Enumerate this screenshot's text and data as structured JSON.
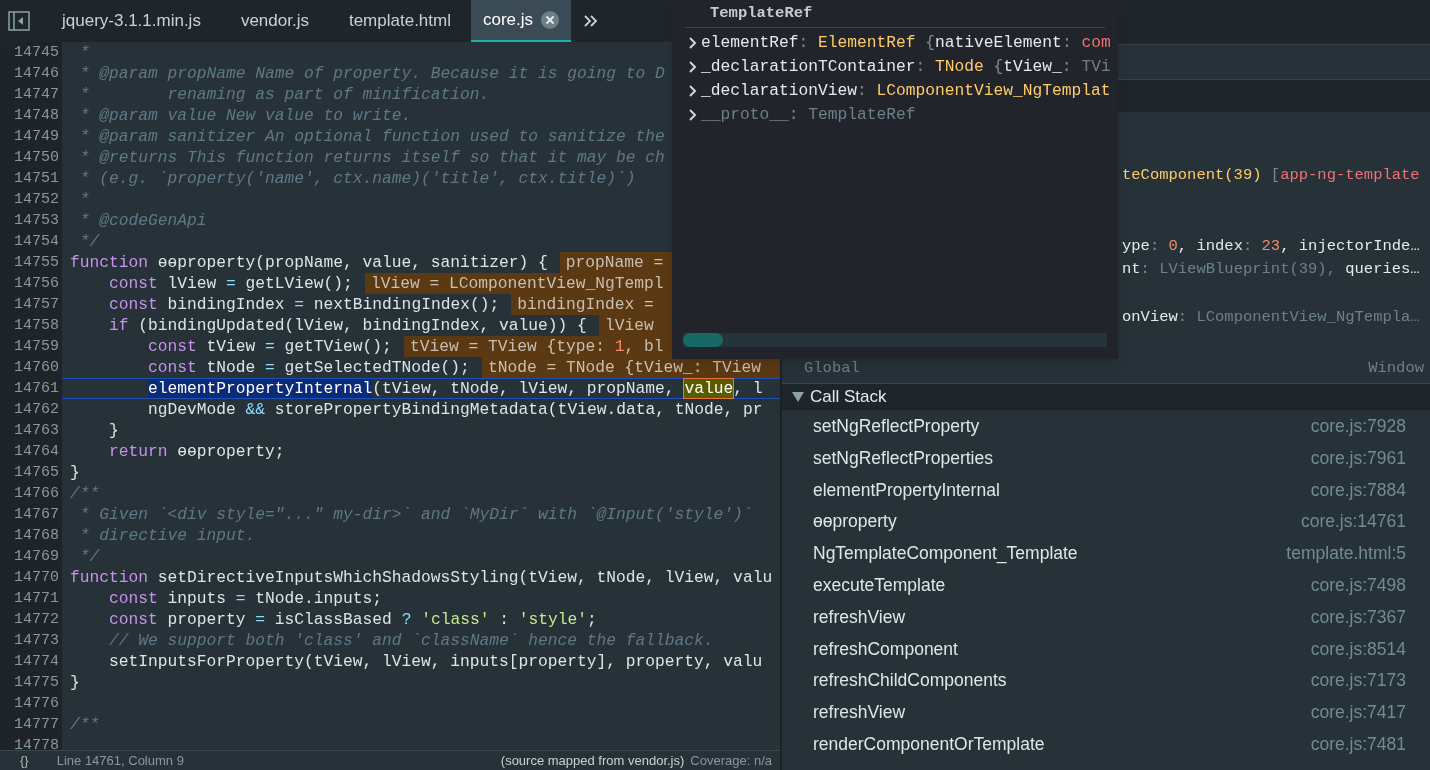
{
  "tabs": [
    {
      "label": "jquery-3.1.1.min.js",
      "selected": false
    },
    {
      "label": "vendor.js",
      "selected": false
    },
    {
      "label": "template.html",
      "selected": false
    },
    {
      "label": "core.js",
      "selected": true
    }
  ],
  "code": {
    "lines": [
      {
        "number": "14745",
        "tokens": [
          {
            "kind": "comment",
            "text": " *"
          }
        ]
      },
      {
        "number": "14746",
        "tokens": [
          {
            "kind": "comment",
            "text": " * @param propName Name of property. Because it is going to D"
          }
        ]
      },
      {
        "number": "14747",
        "tokens": [
          {
            "kind": "comment",
            "text": " *        renaming as part of minification."
          }
        ]
      },
      {
        "number": "14748",
        "tokens": [
          {
            "kind": "comment",
            "text": " * @param value New value to write."
          }
        ]
      },
      {
        "number": "14749",
        "tokens": [
          {
            "kind": "comment",
            "text": " * @param sanitizer An optional function used to sanitize the"
          }
        ]
      },
      {
        "number": "14750",
        "tokens": [
          {
            "kind": "comment",
            "text": " * @returns This function returns itself so that it may be ch"
          }
        ]
      },
      {
        "number": "14751",
        "tokens": [
          {
            "kind": "comment",
            "text": " * (e.g. `property('name', ctx.name)('title', ctx.title)`)"
          }
        ]
      },
      {
        "number": "14752",
        "tokens": [
          {
            "kind": "comment",
            "text": " *"
          }
        ]
      },
      {
        "number": "14753",
        "tokens": [
          {
            "kind": "comment",
            "text": " * @codeGenApi"
          }
        ]
      },
      {
        "number": "14754",
        "tokens": [
          {
            "kind": "comment",
            "text": " */"
          }
        ]
      },
      {
        "number": "14755",
        "tokens": [
          {
            "kind": "keyword",
            "text": "function"
          },
          {
            "kind": "plain",
            "text": " ɵɵproperty(propName, value, sanitizer) {"
          }
        ],
        "inline_value": [
          {
            "kind": "plain",
            "text": "propName ="
          }
        ]
      },
      {
        "number": "14756",
        "tokens": [
          {
            "kind": "keyword",
            "text": "    const"
          },
          {
            "kind": "plain",
            "text": " lView "
          },
          {
            "kind": "operator",
            "text": "="
          },
          {
            "kind": "plain",
            "text": " getLView();"
          }
        ],
        "inline_value": [
          {
            "kind": "plain",
            "text": "lView = LComponentView_NgTempl"
          }
        ]
      },
      {
        "number": "14757",
        "tokens": [
          {
            "kind": "keyword",
            "text": "    const"
          },
          {
            "kind": "plain",
            "text": " bindingIndex "
          },
          {
            "kind": "operator",
            "text": "="
          },
          {
            "kind": "plain",
            "text": " nextBindingIndex();"
          }
        ],
        "inline_value": [
          {
            "kind": "plain",
            "text": "bindingIndex ="
          }
        ]
      },
      {
        "number": "14758",
        "tokens": [
          {
            "kind": "keyword",
            "text": "    if"
          },
          {
            "kind": "plain",
            "text": " (bindingUpdated(lView, bindingIndex, value)) {"
          }
        ],
        "inline_value": [
          {
            "kind": "plain",
            "text": "lView"
          }
        ]
      },
      {
        "number": "14759",
        "tokens": [
          {
            "kind": "keyword",
            "text": "        const"
          },
          {
            "kind": "plain",
            "text": " tView "
          },
          {
            "kind": "operator",
            "text": "="
          },
          {
            "kind": "plain",
            "text": " getTView();"
          }
        ],
        "inline_value": [
          {
            "kind": "plain",
            "text": "tView = TView {type: "
          },
          {
            "kind": "number",
            "text": "1"
          },
          {
            "kind": "plain",
            "text": ", bl"
          }
        ]
      },
      {
        "number": "14760",
        "tokens": [
          {
            "kind": "keyword",
            "text": "        const"
          },
          {
            "kind": "plain",
            "text": " tNode "
          },
          {
            "kind": "operator",
            "text": "="
          },
          {
            "kind": "plain",
            "text": " getSelectedTNode();"
          }
        ],
        "inline_value": [
          {
            "kind": "plain",
            "text": "tNode = TNode {tView_: TView"
          }
        ]
      },
      {
        "number": "14761",
        "current": true,
        "tokens": [
          {
            "kind": "selection",
            "text": "        elementPropertyInternal"
          },
          {
            "kind": "plain",
            "text": "(tView, tNode, lView, propName, "
          },
          {
            "kind": "match",
            "text": "value"
          },
          {
            "kind": "plain",
            "text": ", l"
          }
        ]
      },
      {
        "number": "14762",
        "tokens": [
          {
            "kind": "plain",
            "text": "        ngDevMode "
          },
          {
            "kind": "operator",
            "text": "&&"
          },
          {
            "kind": "plain",
            "text": " storePropertyBindingMetadata(tView.data, tNode, pr"
          }
        ]
      },
      {
        "number": "14763",
        "tokens": [
          {
            "kind": "plain",
            "text": "    }"
          }
        ]
      },
      {
        "number": "14764",
        "tokens": [
          {
            "kind": "keyword",
            "text": "    return"
          },
          {
            "kind": "plain",
            "text": " ɵɵproperty;"
          }
        ]
      },
      {
        "number": "14765",
        "tokens": [
          {
            "kind": "plain",
            "text": "}"
          }
        ]
      },
      {
        "number": "14766",
        "tokens": [
          {
            "kind": "comment",
            "text": "/**"
          }
        ]
      },
      {
        "number": "14767",
        "tokens": [
          {
            "kind": "comment",
            "text": " * Given `<div style=\"...\" my-dir>` and `MyDir` with `@Input('style')`"
          }
        ]
      },
      {
        "number": "14768",
        "tokens": [
          {
            "kind": "comment",
            "text": " * directive input."
          }
        ]
      },
      {
        "number": "14769",
        "tokens": [
          {
            "kind": "comment",
            "text": " */"
          }
        ]
      },
      {
        "number": "14770",
        "tokens": [
          {
            "kind": "keyword",
            "text": "function"
          },
          {
            "kind": "plain",
            "text": " setDirectiveInputsWhichShadowsStyling(tView, tNode, lView, valu"
          }
        ]
      },
      {
        "number": "14771",
        "tokens": [
          {
            "kind": "keyword",
            "text": "    const"
          },
          {
            "kind": "plain",
            "text": " inputs "
          },
          {
            "kind": "operator",
            "text": "="
          },
          {
            "kind": "plain",
            "text": " tNode.inputs;"
          }
        ]
      },
      {
        "number": "14772",
        "tokens": [
          {
            "kind": "keyword",
            "text": "    const"
          },
          {
            "kind": "plain",
            "text": " property "
          },
          {
            "kind": "operator",
            "text": "="
          },
          {
            "kind": "plain",
            "text": " isClassBased "
          },
          {
            "kind": "operator",
            "text": "? "
          },
          {
            "kind": "string",
            "text": "'class'"
          },
          {
            "kind": "plain",
            "text": " : "
          },
          {
            "kind": "string",
            "text": "'style'"
          },
          {
            "kind": "plain",
            "text": ";"
          }
        ]
      },
      {
        "number": "14773",
        "tokens": [
          {
            "kind": "comment",
            "text": "    // We support both 'class' and `className` hence the fallback."
          }
        ]
      },
      {
        "number": "14774",
        "tokens": [
          {
            "kind": "plain",
            "text": "    setInputsForProperty(tView, lView, inputs[property], property, valu"
          }
        ]
      },
      {
        "number": "14775",
        "tokens": [
          {
            "kind": "plain",
            "text": "}"
          }
        ]
      },
      {
        "number": "14776"
      },
      {
        "number": "14777",
        "tokens": [
          {
            "kind": "comment",
            "text": "/**"
          }
        ]
      },
      {
        "number": "14778"
      }
    ]
  },
  "status_bar": {
    "icon_text": "{}",
    "position": "Line 14761, Column 9",
    "source": "(source mapped from vendor.js)",
    "coverage": "Coverage: n/a"
  },
  "popover": {
    "title": "TemplateRef",
    "rows": [
      {
        "tokens": [
          {
            "kind": "key",
            "text": "elementRef"
          },
          {
            "kind": "punct",
            "text": ": "
          },
          {
            "kind": "type",
            "text": "ElementRef"
          },
          {
            "kind": "punct",
            "text": " {"
          },
          {
            "kind": "key",
            "text": "nativeElement"
          },
          {
            "kind": "punct",
            "text": ": "
          },
          {
            "kind": "red",
            "text": "com"
          }
        ]
      },
      {
        "tokens": [
          {
            "kind": "key",
            "text": "_declarationTContainer"
          },
          {
            "kind": "punct",
            "text": ": "
          },
          {
            "kind": "type",
            "text": "TNode"
          },
          {
            "kind": "punct",
            "text": " {"
          },
          {
            "kind": "key",
            "text": "tView_"
          },
          {
            "kind": "punct",
            "text": ": "
          },
          {
            "kind": "dim",
            "text": "TVi"
          }
        ]
      },
      {
        "tokens": [
          {
            "kind": "key",
            "text": "_declarationView"
          },
          {
            "kind": "punct",
            "text": ": "
          },
          {
            "kind": "type",
            "text": "LComponentView_NgTemplat"
          }
        ]
      },
      {
        "tokens": [
          {
            "kind": "dim",
            "text": "__proto__"
          },
          {
            "kind": "punct",
            "text": ": "
          },
          {
            "kind": "dim",
            "text": "TemplateRef"
          }
        ]
      }
    ]
  },
  "scope": {
    "rows": [
      {
        "tokens": [
          {
            "kind": "type",
            "text": "teComponent(39)"
          },
          {
            "kind": "punct",
            "text": " ["
          },
          {
            "kind": "red",
            "text": "app-ng-template"
          }
        ]
      },
      {
        "tokens": [
          {
            "kind": "key",
            "text": "ype"
          },
          {
            "kind": "punct",
            "text": ": "
          },
          {
            "kind": "number",
            "text": "0"
          },
          {
            "kind": "key",
            "text": ", index"
          },
          {
            "kind": "punct",
            "text": ": "
          },
          {
            "kind": "number",
            "text": "23"
          },
          {
            "kind": "key",
            "text": ", injectorInde…"
          }
        ]
      },
      {
        "tokens": [
          {
            "kind": "key",
            "text": "nt"
          },
          {
            "kind": "punct",
            "text": ": "
          },
          {
            "kind": "dim",
            "text": "LViewBlueprint(39), "
          },
          {
            "kind": "key",
            "text": "queries…"
          }
        ]
      },
      {
        "tokens": [
          {
            "kind": "key",
            "text": "onView"
          },
          {
            "kind": "punct",
            "text": ": "
          },
          {
            "kind": "dim",
            "text": "LComponentView_NgTempla…"
          }
        ]
      }
    ],
    "global": {
      "label": "Global",
      "value": "Window"
    }
  },
  "call_stack": {
    "title": "Call Stack",
    "expanded": true,
    "frames": [
      {
        "name": "setNgReflectProperty",
        "location": "core.js:7928"
      },
      {
        "name": "setNgReflectProperties",
        "location": "core.js:7961"
      },
      {
        "name": "elementPropertyInternal",
        "location": "core.js:7884"
      },
      {
        "name": "ɵɵproperty",
        "location": "core.js:14761"
      },
      {
        "name": "NgTemplateComponent_Template",
        "location": "template.html:5"
      },
      {
        "name": "executeTemplate",
        "location": "core.js:7498"
      },
      {
        "name": "refreshView",
        "location": "core.js:7367"
      },
      {
        "name": "refreshComponent",
        "location": "core.js:8514"
      },
      {
        "name": "refreshChildComponents",
        "location": "core.js:7173"
      },
      {
        "name": "refreshView",
        "location": "core.js:7417"
      },
      {
        "name": "renderComponentOrTemplate",
        "location": "core.js:7481"
      }
    ]
  }
}
